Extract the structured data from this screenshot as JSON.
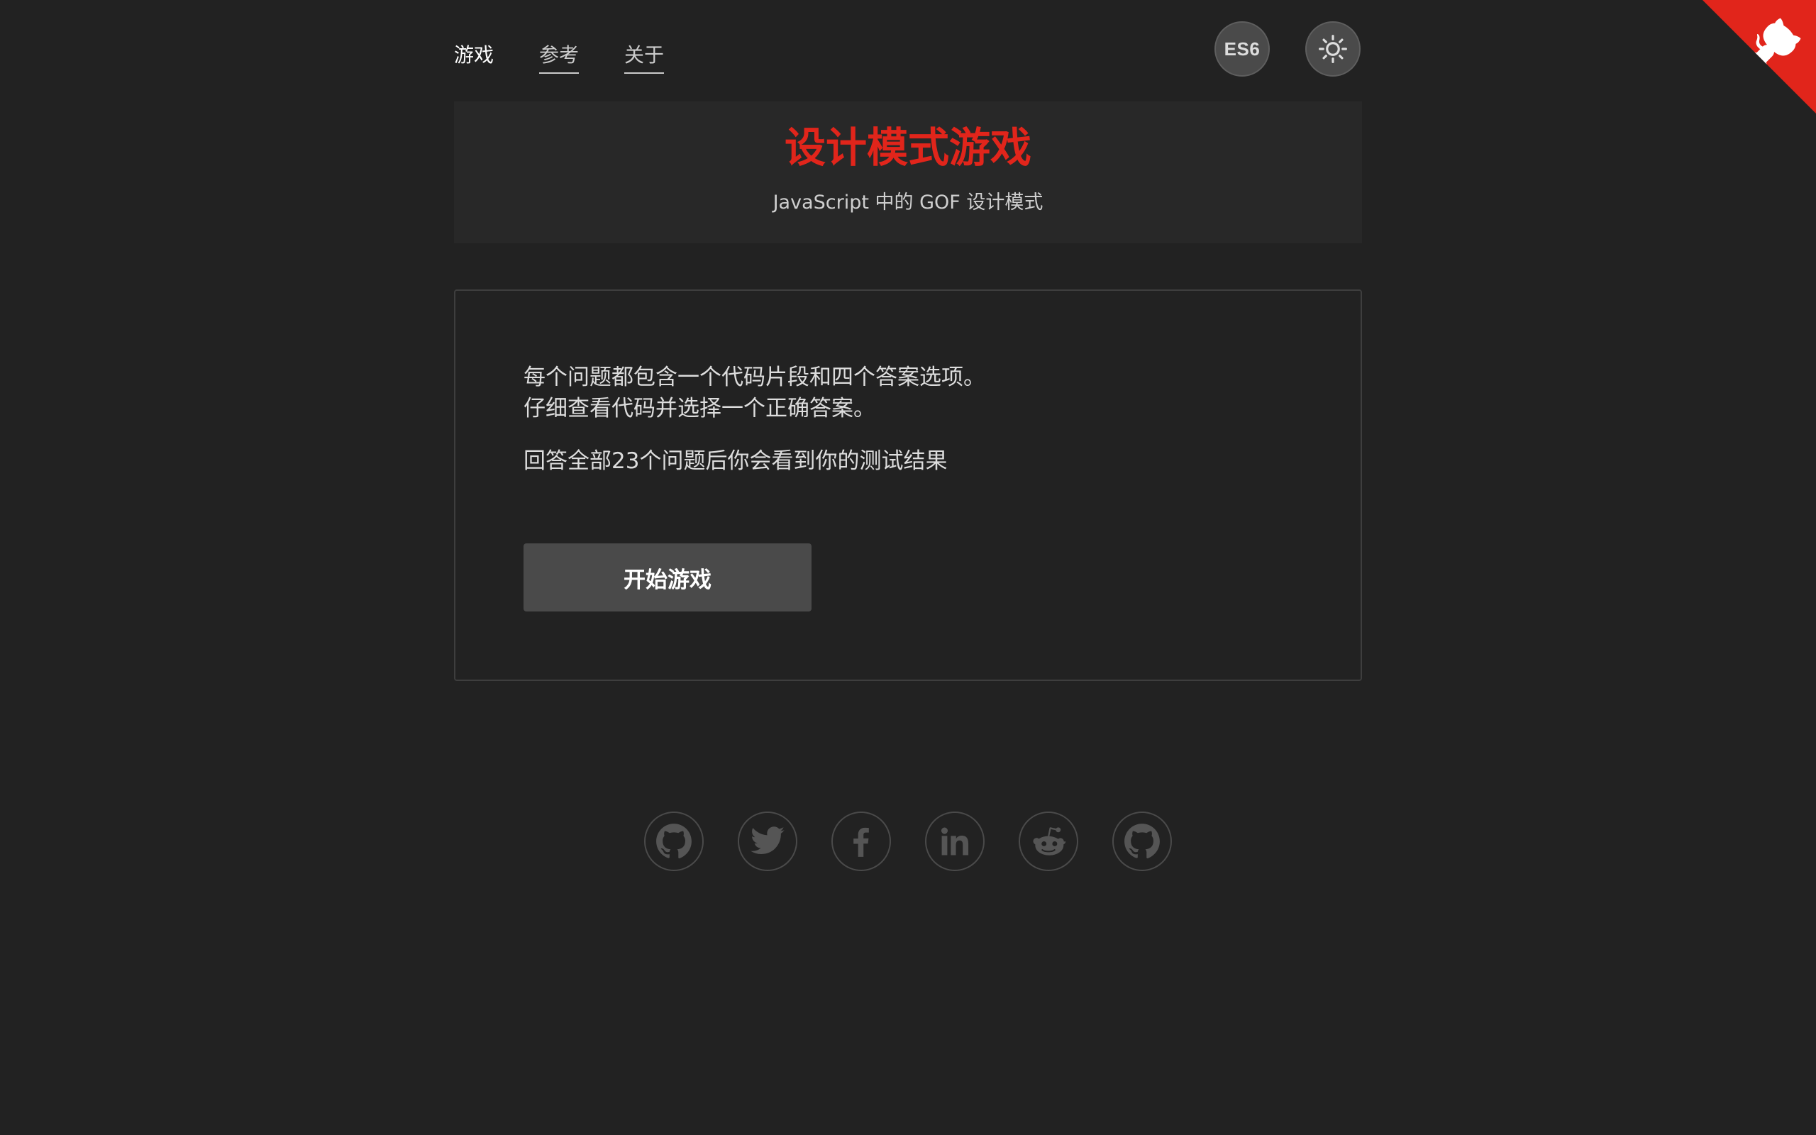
{
  "nav": {
    "items": [
      {
        "label": "游戏"
      },
      {
        "label": "参考"
      },
      {
        "label": "关于"
      }
    ]
  },
  "header": {
    "es6_label": "ES6",
    "theme_icon": "sun-icon"
  },
  "hero": {
    "title": "设计模式游戏",
    "subtitle": "JavaScript 中的 GOF 设计模式"
  },
  "intro": {
    "line1": "每个问题都包含一个代码片段和四个答案选项。",
    "line2": "仔细查看代码并选择一个正确答案。",
    "line3": "回答全部23个问题后你会看到你的测试结果",
    "start_label": "开始游戏"
  },
  "social": {
    "icons": [
      "github-icon",
      "twitter-icon",
      "facebook-icon",
      "linkedin-icon",
      "reddit-icon",
      "github-icon"
    ]
  },
  "colors": {
    "background": "#222222",
    "accent": "#e1251b",
    "button": "#4a4a4a"
  }
}
